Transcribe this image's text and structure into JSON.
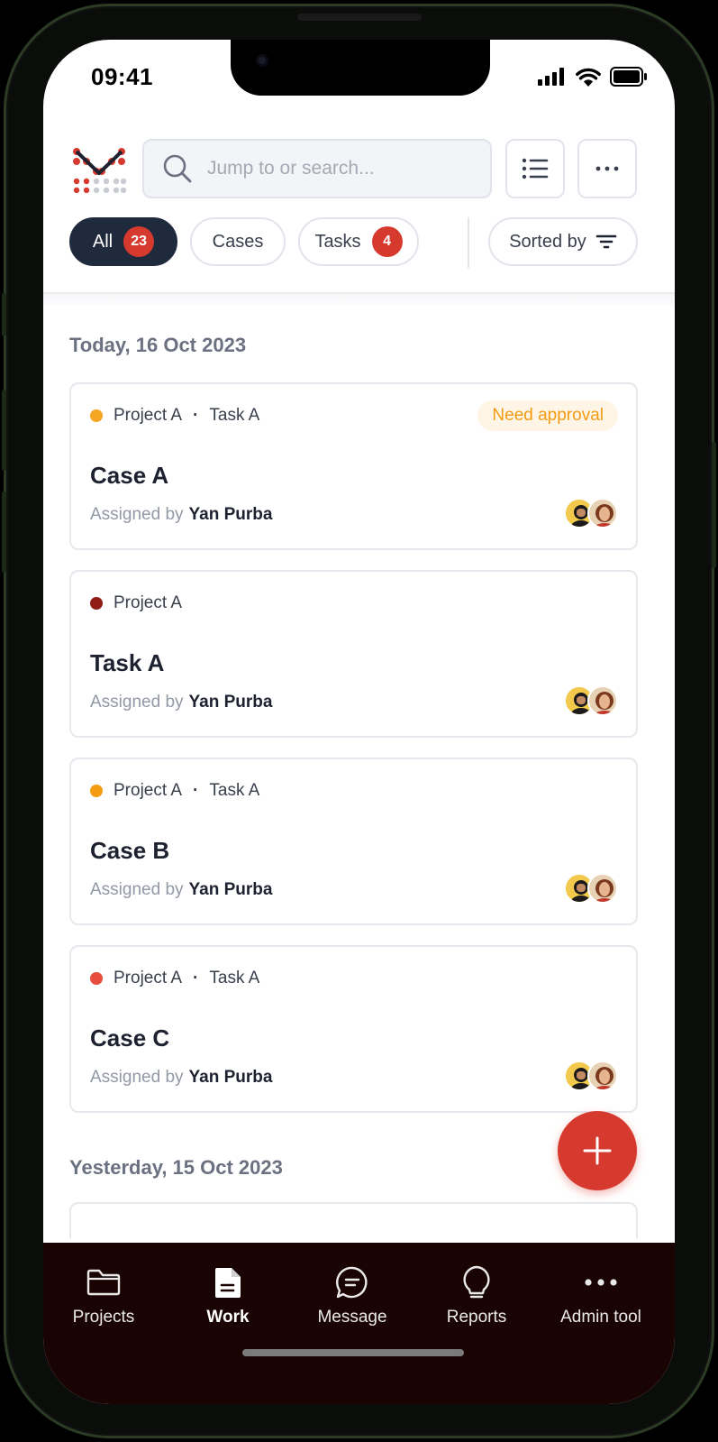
{
  "status_bar": {
    "time": "09:41"
  },
  "search": {
    "placeholder": "Jump to or search..."
  },
  "filters": [
    {
      "label": "All",
      "badge": "23",
      "active": true
    },
    {
      "label": "Cases",
      "active": false
    },
    {
      "label": "Tasks",
      "badge": "4",
      "active": false
    }
  ],
  "sort": {
    "label": "Sorted by"
  },
  "sections": [
    {
      "date": "Today, 16 Oct 2023"
    },
    {
      "date": "Yesterday, 15 Oct 2023"
    }
  ],
  "items": [
    {
      "project": "Project A",
      "task": "Task A",
      "dot_color": "#f5a623",
      "status": "Need approval",
      "title": "Case A",
      "assigned_prefix": "Assigned by",
      "assigned_by": "Yan Purba"
    },
    {
      "project": "Project A",
      "task": "",
      "dot_color": "#8f1c16",
      "status": "",
      "title": "Task A",
      "assigned_prefix": "Assigned by",
      "assigned_by": "Yan Purba"
    },
    {
      "project": "Project A",
      "task": "Task A",
      "dot_color": "#f39c12",
      "status": "",
      "title": "Case B",
      "assigned_prefix": "Assigned by",
      "assigned_by": "Yan Purba"
    },
    {
      "project": "Project A",
      "task": "Task A",
      "dot_color": "#e74c3c",
      "status": "",
      "title": "Case C",
      "assigned_prefix": "Assigned by",
      "assigned_by": "Yan Purba"
    }
  ],
  "bottom_nav": [
    {
      "label": "Projects",
      "icon": "folder-icon",
      "active": false
    },
    {
      "label": "Work",
      "icon": "document-icon",
      "active": true
    },
    {
      "label": "Message",
      "icon": "chat-icon",
      "active": false
    },
    {
      "label": "Reports",
      "icon": "lightbulb-icon",
      "active": false
    },
    {
      "label": "Admin tool",
      "icon": "more-dots-icon",
      "active": false
    }
  ],
  "colors": {
    "accent": "#d63a2f",
    "dark": "#1f2a3c",
    "nav_bg": "#1a0403",
    "pending": "#f39c12"
  }
}
